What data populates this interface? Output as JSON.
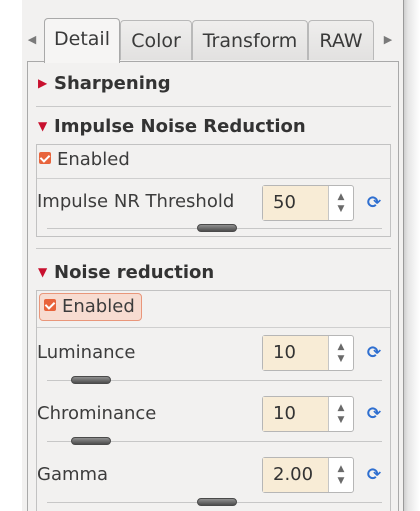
{
  "tabs": [
    "Detail",
    "Color",
    "Transform",
    "RAW"
  ],
  "tab_nav": {
    "prev": "◀",
    "next": "▶"
  },
  "sections": {
    "sharpening": {
      "title": "Sharpening",
      "arrow": "▶"
    },
    "impulse": {
      "title": "Impulse Noise Reduction",
      "arrow": "▼",
      "enabled_label": "Enabled",
      "threshold": {
        "label": "Impulse NR Threshold",
        "value": "50",
        "slider_fraction": 0.5
      }
    },
    "noise": {
      "title": "Noise reduction",
      "arrow": "▼",
      "enabled_label": "Enabled",
      "luminance": {
        "label": "Luminance",
        "value": "10",
        "slider_fraction": 0.1
      },
      "chrominance": {
        "label": "Chrominance",
        "value": "10",
        "slider_fraction": 0.1
      },
      "gamma": {
        "label": "Gamma",
        "value": "2.00",
        "slider_fraction": 0.5
      }
    }
  },
  "icons": {
    "spin_up": "▲",
    "spin_down": "▼",
    "reset": "⟳"
  },
  "colors": {
    "accent": "#e8643c",
    "section_arrow": "#c8102e",
    "reset_icon": "#2f6fd0",
    "spin_value_bg": "#f8ecd6"
  }
}
